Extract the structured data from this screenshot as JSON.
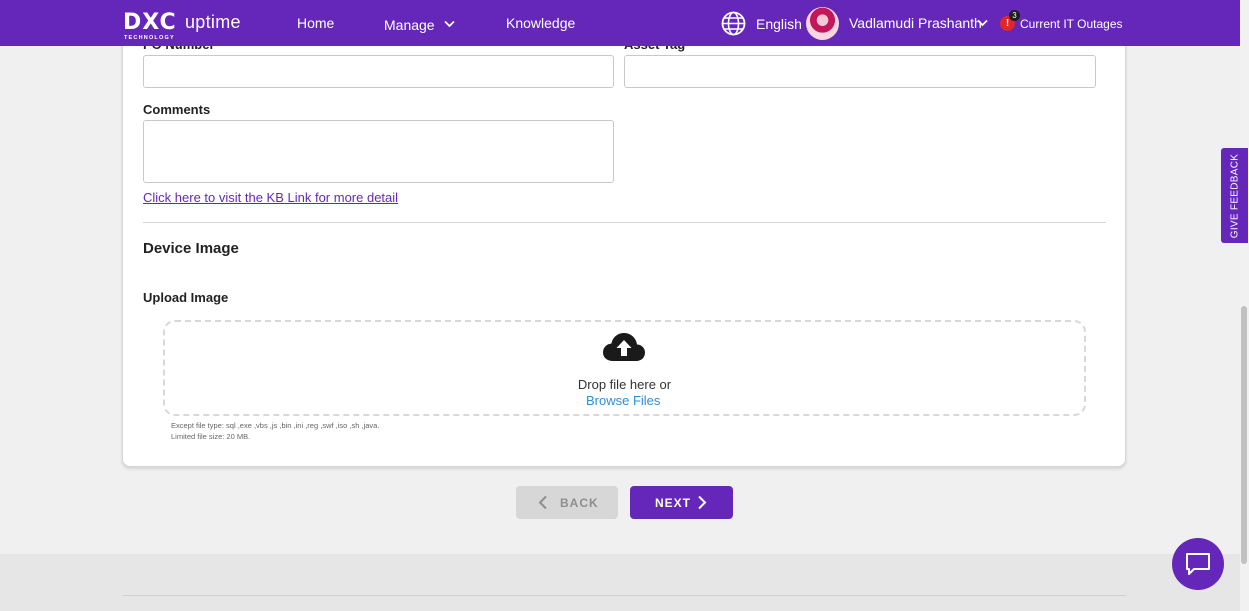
{
  "header": {
    "logo_text": "DXC",
    "logo_subtext": "TECHNOLOGY",
    "app_name": "uptime",
    "nav": {
      "home": "Home",
      "manage": "Manage",
      "knowledge": "Knowledge"
    },
    "language": "English",
    "user_name": "Vadlamudi Prashanth",
    "outages_count": "3",
    "outages_alert": "!",
    "outages_label": "Current IT Outages"
  },
  "form": {
    "po_number_label": "PO Number",
    "asset_tag_label": "Asset Tag",
    "po_number_value": "",
    "asset_tag_value": "",
    "comments_label": "Comments",
    "comments_value": "",
    "kb_link": "Click here to visit the KB Link for more detail"
  },
  "device_image": {
    "section_title": "Device Image",
    "upload_label": "Upload Image",
    "drop_text": "Drop file here or",
    "browse_text": "Browse Files",
    "except_hint": "Except file type: sql ,exe ,vbs ,js ,bin ,ini ,reg ,swf ,iso ,sh ,java.",
    "size_hint": "Limited file size: 20 MB."
  },
  "buttons": {
    "back": "BACK",
    "next": "NEXT"
  },
  "side_tab": "GIVE FEEDBACK",
  "icons": {
    "globe": "globe-icon",
    "upload": "cloud-upload-icon",
    "chat": "chat-icon"
  },
  "colors": {
    "brand": "#6527b9",
    "link": "#2b8fd9",
    "alert": "#e0262b",
    "disabled": "#d7d7d7"
  }
}
